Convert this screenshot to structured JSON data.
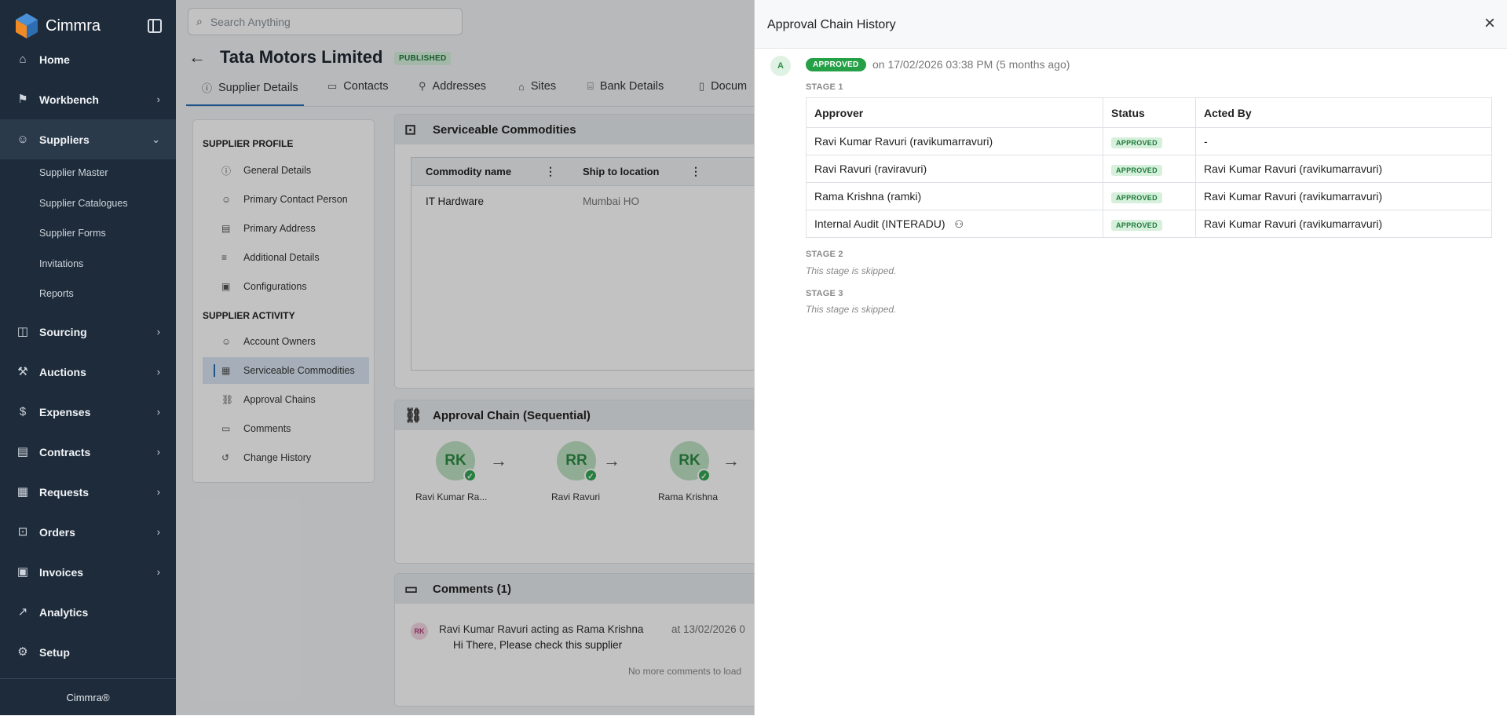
{
  "sidebar": {
    "brand": "Cimmra",
    "nav": [
      {
        "label": "Home",
        "icon": "home-icon"
      },
      {
        "label": "Workbench",
        "icon": "flag-icon"
      },
      {
        "label": "Suppliers",
        "icon": "people-icon"
      },
      {
        "label": "Sourcing",
        "icon": "bag-icon"
      },
      {
        "label": "Auctions",
        "icon": "gavel-icon"
      },
      {
        "label": "Expenses",
        "icon": "expense-icon"
      },
      {
        "label": "Contracts",
        "icon": "contract-icon"
      },
      {
        "label": "Requests",
        "icon": "request-icon"
      },
      {
        "label": "Orders",
        "icon": "cart-icon"
      },
      {
        "label": "Invoices",
        "icon": "invoice-icon"
      },
      {
        "label": "Analytics",
        "icon": "trend-icon"
      },
      {
        "label": "Setup",
        "icon": "gear-icon"
      }
    ],
    "supplier_sub": [
      "Supplier Master",
      "Supplier Catalogues",
      "Supplier Forms",
      "Invitations",
      "Reports"
    ],
    "footer": "Cimmra®"
  },
  "header": {
    "search_placeholder": "Search Anything",
    "title": "Tata Motors Limited",
    "status": "PUBLISHED"
  },
  "tabs": [
    "Supplier Details",
    "Contacts",
    "Addresses",
    "Sites",
    "Bank Details",
    "Docum"
  ],
  "profile": {
    "profile_heading": "SUPPLIER PROFILE",
    "profile_items": [
      "General Details",
      "Primary Contact Person",
      "Primary Address",
      "Additional Details",
      "Configurations"
    ],
    "activity_heading": "SUPPLIER ACTIVITY",
    "activity_items": [
      "Account Owners",
      "Serviceable Commodities",
      "Approval Chains",
      "Comments",
      "Change History"
    ]
  },
  "commodities": {
    "title": "Serviceable Commodities",
    "col_name": "Commodity name",
    "col_location": "Ship to location",
    "row_name": "IT Hardware",
    "row_location": "Mumbai HO"
  },
  "approval_chain": {
    "title": "Approval Chain (Sequential)",
    "nodes": [
      {
        "initials": "RK",
        "label": "Ravi Kumar Ra..."
      },
      {
        "initials": "RR",
        "label": "Ravi Ravuri"
      },
      {
        "initials": "RK",
        "label": "Rama Krishna"
      }
    ]
  },
  "comments": {
    "title": "Comments (1)",
    "avatar": "RK",
    "author": "Ravi Kumar Ravuri acting as Rama Krishna",
    "time": "at 13/02/2026 0",
    "text": "Hi There, Please check this supplier",
    "footer": "No more comments to load"
  },
  "drawer": {
    "title": "Approval Chain History",
    "avatar": "A",
    "status": "APPROVED",
    "when": "on 17/02/2026 03:38 PM (5 months ago)",
    "stage1": "STAGE 1",
    "headers": [
      "Approver",
      "Status",
      "Acted By"
    ],
    "rows": [
      {
        "approver": "Ravi Kumar Ravuri (ravikumarravuri)",
        "status": "APPROVED",
        "acted_by": "-"
      },
      {
        "approver": "Ravi Ravuri (raviravuri)",
        "status": "APPROVED",
        "acted_by": "Ravi Kumar Ravuri (ravikumarravuri)"
      },
      {
        "approver": "Rama Krishna (ramki)",
        "status": "APPROVED",
        "acted_by": "Ravi Kumar Ravuri (ravikumarravuri)"
      },
      {
        "approver": "Internal Audit (INTERADU)",
        "status": "APPROVED",
        "acted_by": "Ravi Kumar Ravuri (ravikumarravuri)"
      }
    ],
    "stage2": "STAGE 2",
    "stage2_note": "This stage is skipped.",
    "stage3": "STAGE 3",
    "stage3_note": "This stage is skipped."
  }
}
